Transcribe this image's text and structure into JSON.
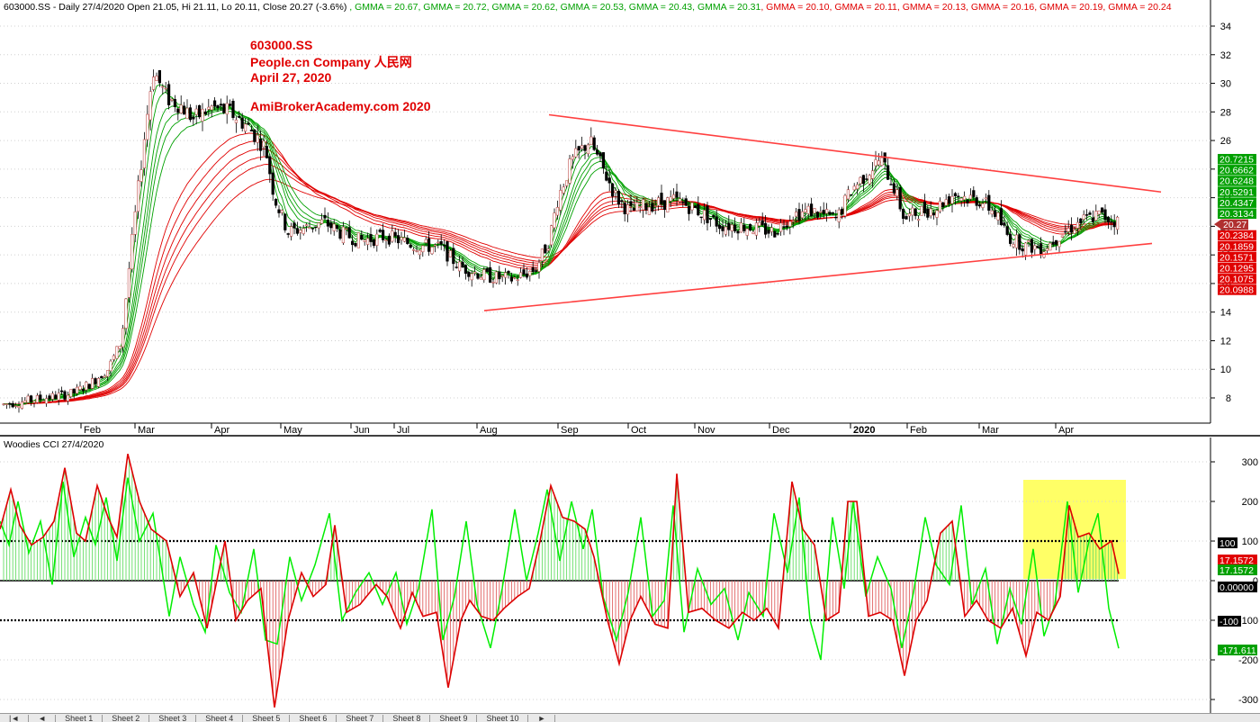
{
  "header": {
    "symbol_info": "603000.SS - Daily 27/4/2020 Open 21.05, Hi 21.11, Lo 20.11, Close 20.27 (-3.6%)",
    "gmma": [
      {
        "label": "GMMA = 20.67",
        "color": "#00a000"
      },
      {
        "label": "GMMA = 20.72",
        "color": "#00a000"
      },
      {
        "label": "GMMA = 20.62",
        "color": "#00a000"
      },
      {
        "label": "GMMA = 20.53",
        "color": "#00a000"
      },
      {
        "label": "GMMA = 20.43",
        "color": "#00a000"
      },
      {
        "label": "GMMA = 20.31",
        "color": "#00a000"
      },
      {
        "label": "GMMA = 20.10",
        "color": "#e00000"
      },
      {
        "label": "GMMA = 20.11",
        "color": "#e00000"
      },
      {
        "label": "GMMA = 20.13",
        "color": "#e00000"
      },
      {
        "label": "GMMA = 20.16",
        "color": "#e00000"
      },
      {
        "label": "GMMA = 20.19",
        "color": "#e00000"
      },
      {
        "label": "GMMA = 20.24",
        "color": "#e00000"
      }
    ]
  },
  "annotation": {
    "line1": "603000.SS",
    "line2": "People.cn Company  人民网",
    "line3": "April 27, 2020",
    "line4": "AmiBrokerAcademy.com   2020"
  },
  "cci_header": "Woodies CCI  27/4/2020",
  "colors": {
    "bull": "#00a000",
    "bear": "#e00000",
    "cci_green": "#00ee00",
    "cci_red": "#dd0000",
    "trend": "#ff4040",
    "highlight": "#ffff66"
  },
  "chart_data": [
    {
      "type": "candlestick",
      "title": "603000.SS - Daily 27/4/2020",
      "ylim": [
        7,
        35
      ],
      "y_ticks": [
        "34",
        "32",
        "30",
        "28",
        "26",
        "24",
        "22",
        "20",
        "18",
        "16",
        "14",
        "12",
        "10",
        "8"
      ],
      "x_month_labels": [
        "Feb",
        "Mar",
        "Apr",
        "May",
        "Jun",
        "Jul",
        "Aug",
        "Sep",
        "Oct",
        "Nov",
        "Dec",
        "2020",
        "Feb",
        "Mar",
        "Apr"
      ],
      "price_path": [
        [
          0,
          7.5
        ],
        [
          40,
          7.9
        ],
        [
          80,
          8.3
        ],
        [
          100,
          9
        ],
        [
          120,
          10
        ],
        [
          135,
          12
        ],
        [
          145,
          18
        ],
        [
          158,
          25
        ],
        [
          170,
          31
        ],
        [
          185,
          29
        ],
        [
          200,
          28.5
        ],
        [
          215,
          27.5
        ],
        [
          235,
          28.3
        ],
        [
          255,
          28
        ],
        [
          275,
          27
        ],
        [
          295,
          25.5
        ],
        [
          305,
          22
        ],
        [
          320,
          19.6
        ],
        [
          340,
          19.9
        ],
        [
          360,
          20.3
        ],
        [
          380,
          19.5
        ],
        [
          400,
          19
        ],
        [
          430,
          19.3
        ],
        [
          460,
          18.7
        ],
        [
          490,
          18.5
        ],
        [
          510,
          17.2
        ],
        [
          540,
          16.5
        ],
        [
          570,
          16.3
        ],
        [
          595,
          17
        ],
        [
          610,
          19
        ],
        [
          620,
          22
        ],
        [
          635,
          24.5
        ],
        [
          655,
          26
        ],
        [
          670,
          24
        ],
        [
          685,
          22
        ],
        [
          700,
          21
        ],
        [
          720,
          21.5
        ],
        [
          750,
          21.8
        ],
        [
          770,
          21.3
        ],
        [
          800,
          20.1
        ],
        [
          830,
          20
        ],
        [
          860,
          19.6
        ],
        [
          880,
          20.8
        ],
        [
          900,
          21.1
        ],
        [
          930,
          20.5
        ],
        [
          945,
          22.5
        ],
        [
          960,
          23.5
        ],
        [
          978,
          24.7
        ],
        [
          992,
          23
        ],
        [
          1005,
          20.5
        ],
        [
          1020,
          21
        ],
        [
          1040,
          21.3
        ],
        [
          1060,
          22.3
        ],
        [
          1075,
          22
        ],
        [
          1090,
          21.8
        ],
        [
          1105,
          21
        ],
        [
          1120,
          19.3
        ],
        [
          1140,
          18.6
        ],
        [
          1160,
          18.5
        ],
        [
          1180,
          19.5
        ],
        [
          1200,
          20.3
        ],
        [
          1220,
          20.8
        ],
        [
          1243,
          20.3
        ]
      ],
      "gmma_latest": {
        "short": [
          20.7215,
          20.6662,
          20.6248,
          20.5291,
          20.4347,
          20.3134
        ],
        "long": [
          20.2384,
          20.1859,
          20.1571,
          20.1295,
          20.1075,
          20.0988
        ]
      },
      "last_close": 20.27,
      "right_tags": [
        {
          "label": "20.7215",
          "color": "#00a000"
        },
        {
          "label": "20.6662",
          "color": "#00a000"
        },
        {
          "label": "20.6248",
          "color": "#00a000"
        },
        {
          "label": "20.5291",
          "color": "#00a000"
        },
        {
          "label": "20.4347",
          "color": "#00a000"
        },
        {
          "label": "20.3134",
          "color": "#00a000"
        },
        {
          "label": "20.27",
          "color": "#b03030"
        },
        {
          "label": "20.2384",
          "color": "#e00000"
        },
        {
          "label": "20.1859",
          "color": "#e00000"
        },
        {
          "label": "20.1571",
          "color": "#e00000"
        },
        {
          "label": "20.1295",
          "color": "#e00000"
        },
        {
          "label": "20.1075",
          "color": "#e00000"
        },
        {
          "label": "20.0988",
          "color": "#e00000"
        }
      ],
      "trendlines": [
        {
          "from": [
            "Sep",
            27.8
          ],
          "to": [
            "end",
            22.4
          ]
        },
        {
          "from": [
            "Aug",
            14.1
          ],
          "to": [
            "end",
            18.8
          ]
        }
      ]
    },
    {
      "type": "line+bar",
      "title": "Woodies CCI  27/4/2020",
      "ylim": [
        -340,
        340
      ],
      "y_ticks": [
        "300",
        "200",
        "100",
        "0",
        "-100",
        "-200",
        "-300"
      ],
      "reference_lines": [
        100,
        0,
        -100
      ],
      "series": [
        {
          "name": "CCI",
          "color": "#dd0000"
        },
        {
          "name": "Turbo CCI",
          "color": "#00ee00"
        }
      ],
      "latest": {
        "cci": 17.1572,
        "turbo": -171.611
      },
      "right_tags": [
        {
          "label": "100",
          "value": 100
        },
        {
          "label": "17.1572",
          "value": 17.1572,
          "color": "#e00000"
        },
        {
          "label": "17.1572",
          "value": 17.1572,
          "color": "#00a000"
        },
        {
          "label": "0.00000",
          "value": 0
        },
        {
          "label": "-100",
          "value": -100
        },
        {
          "label": "-171.611",
          "value": -171.611,
          "color": "#00a000"
        }
      ],
      "cci_path": [
        [
          0,
          130
        ],
        [
          12,
          230
        ],
        [
          22,
          140
        ],
        [
          35,
          90
        ],
        [
          48,
          110
        ],
        [
          60,
          150
        ],
        [
          72,
          285
        ],
        [
          85,
          120
        ],
        [
          95,
          100
        ],
        [
          108,
          240
        ],
        [
          120,
          160
        ],
        [
          130,
          110
        ],
        [
          142,
          320
        ],
        [
          155,
          200
        ],
        [
          168,
          130
        ],
        [
          185,
          100
        ],
        [
          200,
          -40
        ],
        [
          215,
          20
        ],
        [
          230,
          -120
        ],
        [
          250,
          100
        ],
        [
          262,
          -100
        ],
        [
          275,
          -50
        ],
        [
          290,
          -20
        ],
        [
          305,
          -320
        ],
        [
          320,
          -100
        ],
        [
          335,
          20
        ],
        [
          348,
          -40
        ],
        [
          362,
          -10
        ],
        [
          372,
          140
        ],
        [
          385,
          -80
        ],
        [
          400,
          -60
        ],
        [
          418,
          -10
        ],
        [
          430,
          -40
        ],
        [
          445,
          -120
        ],
        [
          458,
          -30
        ],
        [
          470,
          -90
        ],
        [
          485,
          -80
        ],
        [
          498,
          -270
        ],
        [
          512,
          -100
        ],
        [
          522,
          -50
        ],
        [
          535,
          -90
        ],
        [
          548,
          -100
        ],
        [
          560,
          -70
        ],
        [
          575,
          -40
        ],
        [
          588,
          -20
        ],
        [
          600,
          100
        ],
        [
          612,
          240
        ],
        [
          625,
          160
        ],
        [
          638,
          150
        ],
        [
          650,
          130
        ],
        [
          660,
          60
        ],
        [
          675,
          -100
        ],
        [
          688,
          -210
        ],
        [
          700,
          -100
        ],
        [
          712,
          -40
        ],
        [
          728,
          -110
        ],
        [
          742,
          -120
        ],
        [
          752,
          270
        ],
        [
          765,
          -80
        ],
        [
          780,
          -70
        ],
        [
          795,
          -100
        ],
        [
          810,
          -120
        ],
        [
          825,
          -80
        ],
        [
          838,
          -100
        ],
        [
          852,
          -70
        ],
        [
          865,
          -120
        ],
        [
          880,
          250
        ],
        [
          892,
          130
        ],
        [
          905,
          90
        ],
        [
          918,
          -100
        ],
        [
          932,
          -80
        ],
        [
          942,
          200
        ],
        [
          952,
          200
        ],
        [
          965,
          -90
        ],
        [
          978,
          -80
        ],
        [
          992,
          -100
        ],
        [
          1005,
          -240
        ],
        [
          1018,
          -100
        ],
        [
          1030,
          -50
        ],
        [
          1045,
          120
        ],
        [
          1058,
          150
        ],
        [
          1072,
          -90
        ],
        [
          1085,
          -50
        ],
        [
          1098,
          -100
        ],
        [
          1112,
          -120
        ],
        [
          1125,
          -70
        ],
        [
          1140,
          -190
        ],
        [
          1152,
          -80
        ],
        [
          1165,
          -100
        ],
        [
          1178,
          -40
        ],
        [
          1188,
          190
        ],
        [
          1198,
          110
        ],
        [
          1210,
          120
        ],
        [
          1222,
          80
        ],
        [
          1235,
          100
        ],
        [
          1243,
          17
        ]
      ],
      "turbo_path": [
        [
          0,
          150
        ],
        [
          10,
          90
        ],
        [
          20,
          200
        ],
        [
          32,
          70
        ],
        [
          45,
          150
        ],
        [
          58,
          -10
        ],
        [
          70,
          250
        ],
        [
          82,
          60
        ],
        [
          95,
          160
        ],
        [
          106,
          90
        ],
        [
          118,
          210
        ],
        [
          130,
          50
        ],
        [
          142,
          260
        ],
        [
          155,
          100
        ],
        [
          170,
          170
        ],
        [
          188,
          -90
        ],
        [
          200,
          60
        ],
        [
          215,
          -60
        ],
        [
          228,
          -130
        ],
        [
          240,
          90
        ],
        [
          255,
          -30
        ],
        [
          268,
          -80
        ],
        [
          282,
          80
        ],
        [
          295,
          -150
        ],
        [
          308,
          -160
        ],
        [
          322,
          60
        ],
        [
          335,
          -50
        ],
        [
          350,
          40
        ],
        [
          366,
          170
        ],
        [
          380,
          -100
        ],
        [
          395,
          -30
        ],
        [
          410,
          20
        ],
        [
          425,
          -60
        ],
        [
          440,
          20
        ],
        [
          452,
          -110
        ],
        [
          465,
          -20
        ],
        [
          480,
          180
        ],
        [
          492,
          -150
        ],
        [
          505,
          -40
        ],
        [
          518,
          150
        ],
        [
          530,
          -60
        ],
        [
          545,
          -170
        ],
        [
          558,
          -20
        ],
        [
          572,
          180
        ],
        [
          585,
          0
        ],
        [
          598,
          120
        ],
        [
          608,
          230
        ],
        [
          622,
          50
        ],
        [
          635,
          200
        ],
        [
          648,
          80
        ],
        [
          658,
          180
        ],
        [
          670,
          -40
        ],
        [
          685,
          -150
        ],
        [
          698,
          -30
        ],
        [
          712,
          160
        ],
        [
          725,
          -90
        ],
        [
          738,
          -50
        ],
        [
          748,
          190
        ],
        [
          760,
          -130
        ],
        [
          775,
          30
        ],
        [
          790,
          -60
        ],
        [
          805,
          -20
        ],
        [
          820,
          -150
        ],
        [
          832,
          -30
        ],
        [
          848,
          -90
        ],
        [
          860,
          170
        ],
        [
          875,
          20
        ],
        [
          888,
          210
        ],
        [
          900,
          -100
        ],
        [
          912,
          -200
        ],
        [
          925,
          160
        ],
        [
          938,
          -20
        ],
        [
          948,
          200
        ],
        [
          962,
          -40
        ],
        [
          975,
          60
        ],
        [
          990,
          -20
        ],
        [
          1002,
          -170
        ],
        [
          1015,
          -30
        ],
        [
          1028,
          160
        ],
        [
          1040,
          40
        ],
        [
          1055,
          -10
        ],
        [
          1068,
          190
        ],
        [
          1080,
          -60
        ],
        [
          1095,
          30
        ],
        [
          1108,
          -160
        ],
        [
          1122,
          -20
        ],
        [
          1135,
          -110
        ],
        [
          1148,
          80
        ],
        [
          1160,
          -140
        ],
        [
          1172,
          -60
        ],
        [
          1186,
          200
        ],
        [
          1198,
          -30
        ],
        [
          1210,
          100
        ],
        [
          1220,
          170
        ],
        [
          1232,
          -70
        ],
        [
          1243,
          -171
        ]
      ]
    }
  ],
  "sheet_tabs": [
    "|◄",
    "◄",
    "Sheet 1",
    "Sheet 2",
    "Sheet 3",
    "Sheet 4",
    "Sheet 5",
    "Sheet 6",
    "Sheet 7",
    "Sheet 8",
    "Sheet 9",
    "Sheet 10",
    "►"
  ]
}
